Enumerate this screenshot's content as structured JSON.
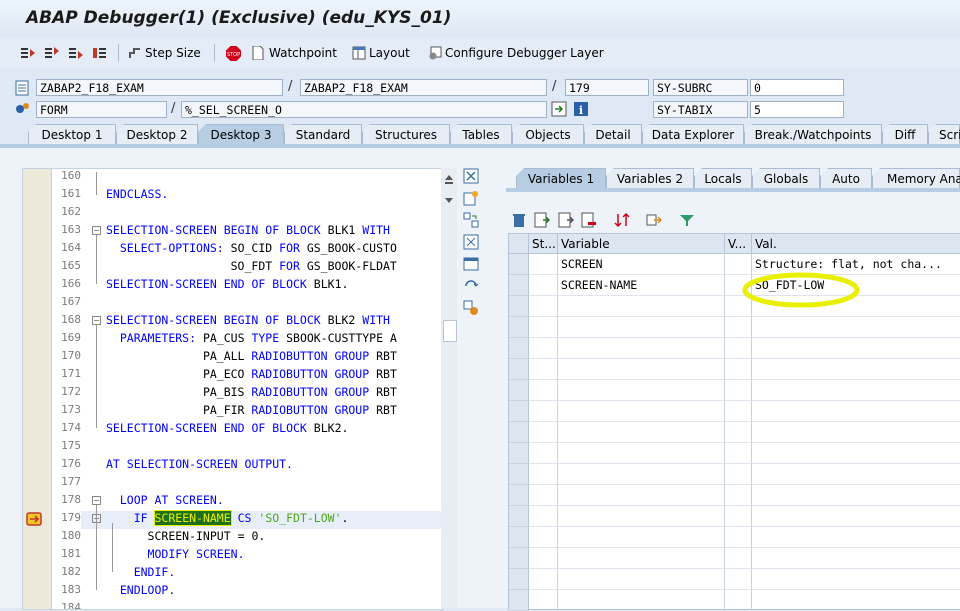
{
  "window": {
    "title": "ABAP Debugger(1)  (Exclusive) (edu_KYS_01)"
  },
  "toolbar": {
    "step_size": "Step Size",
    "watchpoint": "Watchpoint",
    "layout": "Layout",
    "configure": "Configure Debugger Layer"
  },
  "fields": {
    "program": "ZABAP2_F18_EXAM",
    "include": "ZABAP2_F18_EXAM",
    "line": "179",
    "event_type": "FORM",
    "event": "%_SEL_SCREEN_O",
    "sysvar1_name": "SY-SUBRC",
    "sysvar1_value": "0",
    "sysvar2_name": "SY-TABIX",
    "sysvar2_value": "5",
    "slash": "/"
  },
  "main_tabs": [
    "Desktop 1",
    "Desktop 2",
    "Desktop 3",
    "Standard",
    "Structures",
    "Tables",
    "Objects",
    "Detail",
    "Data Explorer",
    "Break./Watchpoints",
    "Diff",
    "Scri"
  ],
  "code_lines": [
    {
      "no": "160",
      "text": ""
    },
    {
      "no": "161",
      "text": "ENDCLASS."
    },
    {
      "no": "162",
      "text": ""
    },
    {
      "no": "163",
      "text": "SELECTION-SCREEN BEGIN OF BLOCK BLK1 WITH"
    },
    {
      "no": "164",
      "text": "  SELECT-OPTIONS: SO_CID FOR GS_BOOK-CUSTO"
    },
    {
      "no": "165",
      "text": "                  SO_FDT FOR GS_BOOK-FLDAT"
    },
    {
      "no": "166",
      "text": "SELECTION-SCREEN END OF BLOCK BLK1."
    },
    {
      "no": "167",
      "text": ""
    },
    {
      "no": "168",
      "text": "SELECTION-SCREEN BEGIN OF BLOCK BLK2 WITH"
    },
    {
      "no": "169",
      "text": "  PARAMETERS: PA_CUS TYPE SBOOK-CUSTTYPE A"
    },
    {
      "no": "170",
      "text": "              PA_ALL RADIOBUTTON GROUP RBT"
    },
    {
      "no": "171",
      "text": "              PA_ECO RADIOBUTTON GROUP RBT"
    },
    {
      "no": "172",
      "text": "              PA_BIS RADIOBUTTON GROUP RBT"
    },
    {
      "no": "173",
      "text": "              PA_FIR RADIOBUTTON GROUP RBT"
    },
    {
      "no": "174",
      "text": "SELECTION-SCREEN END OF BLOCK BLK2."
    },
    {
      "no": "175",
      "text": ""
    },
    {
      "no": "176",
      "text": "AT SELECTION-SCREEN OUTPUT."
    },
    {
      "no": "177",
      "text": ""
    },
    {
      "no": "178",
      "text": "  LOOP AT SCREEN."
    },
    {
      "no": "179",
      "text": "    IF SCREEN-NAME CS 'SO_FDT-LOW'."
    },
    {
      "no": "180",
      "text": "      SCREEN-INPUT = 0."
    },
    {
      "no": "181",
      "text": "      MODIFY SCREEN."
    },
    {
      "no": "182",
      "text": "    ENDIF."
    },
    {
      "no": "183",
      "text": "  ENDLOOP."
    },
    {
      "no": "184",
      "text": ""
    }
  ],
  "var_tabs": [
    "Variables 1",
    "Variables 2",
    "Locals",
    "Globals",
    "Auto",
    "Memory Analy"
  ],
  "grid": {
    "headers": [
      "St...",
      "Variable",
      "V...",
      "Val."
    ],
    "rows": [
      {
        "variable": "SCREEN",
        "value": "Structure: flat, not cha..."
      },
      {
        "variable": "SCREEN-NAME",
        "value": "SO_FDT-LOW"
      }
    ]
  },
  "colors": {
    "keyword": "#0000ff",
    "string": "#4da619",
    "highlight": "#e8f000",
    "tab_active": "#b7cde4"
  }
}
